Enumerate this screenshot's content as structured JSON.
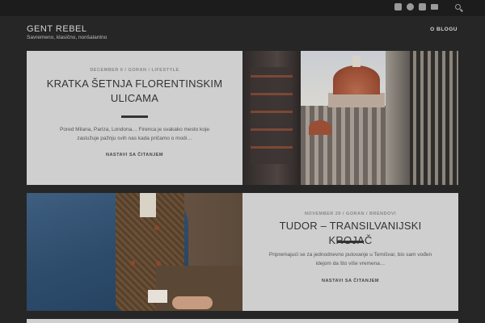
{
  "site": {
    "title": "GENT REBEL",
    "tagline": "Savremeno, klasično, nonšalantno"
  },
  "nav": {
    "blog_label": "O BLOGU"
  },
  "social_icons": [
    "facebook-icon",
    "pinterest-icon",
    "instagram-icon",
    "mail-icon"
  ],
  "posts": [
    {
      "meta": "DECEMBER 6 / GORAN / LIFESTYLE",
      "title": "KRATKA ŠETNJA FLORENTINSKIM ULICAMA",
      "excerpt": "Pored Milana, Pariza, Londona… Firenca je svakako mesto koje zaslužuje pažnju svih nas kada pričamo o modi…",
      "read_more": "NASTAVI SA ČITANJEM"
    },
    {
      "meta": "NOVEMBER 29 / GORAN / BRENDOVI",
      "title": "TUDOR – TRANSILVANIJSKI KROJAČ",
      "excerpt": "Pripremajući se za jednodnevno putovanje u Temišvar, bio sam vođen idejom da što više vremena…",
      "read_more": "NASTAVI SA ČITANJEM"
    }
  ],
  "colors": {
    "background": "#262626",
    "card": "#cfcfcf",
    "topbar": "#1c1c1c"
  }
}
